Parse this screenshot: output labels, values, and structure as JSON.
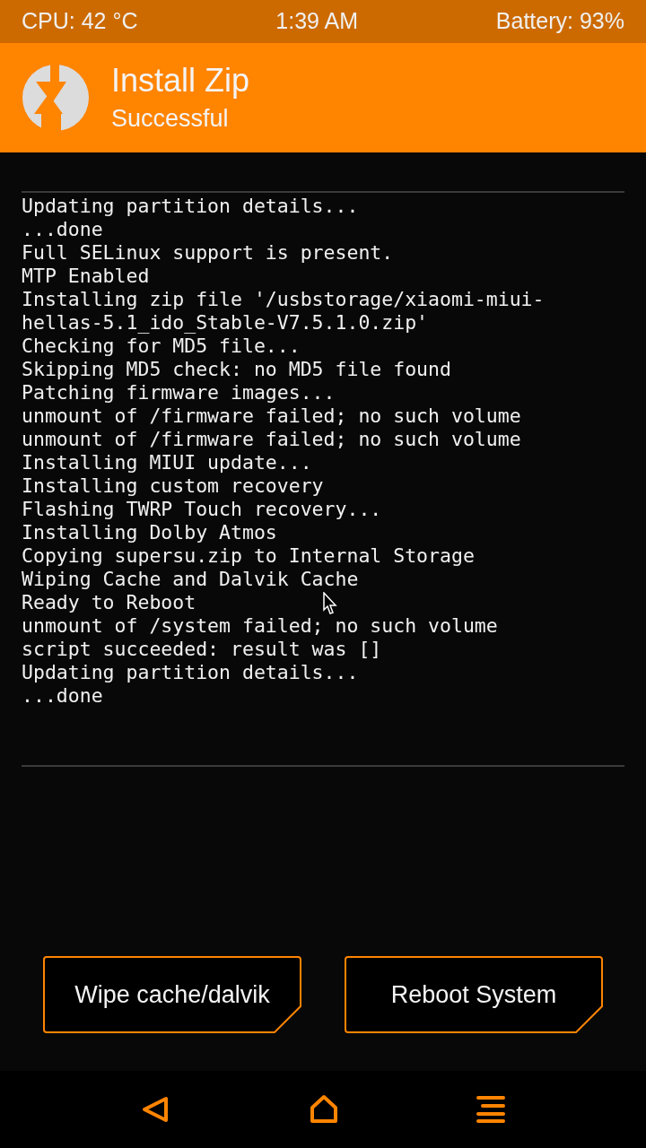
{
  "status_bar": {
    "cpu": "CPU: 42 °C",
    "time": "1:39 AM",
    "battery": "Battery: 93%"
  },
  "header": {
    "title": "Install Zip",
    "subtitle": "Successful"
  },
  "console": {
    "lines": [
      "Updating partition details...",
      "...done",
      "Full SELinux support is present.",
      "MTP Enabled",
      "Installing zip file '/usbstorage/xiaomi-miui-",
      "hellas-5.1_ido_Stable-V7.5.1.0.zip'",
      "Checking for MD5 file...",
      "Skipping MD5 check: no MD5 file found",
      "Patching firmware images...",
      "unmount of /firmware failed; no such volume",
      "unmount of /firmware failed; no such volume",
      "Installing MIUI update...",
      "Installing custom recovery",
      "Flashing TWRP Touch recovery...",
      "Installing Dolby Atmos",
      "Copying supersu.zip to Internal Storage",
      "Wiping Cache and Dalvik Cache",
      "Ready to Reboot",
      "unmount of /system failed; no such volume",
      "script succeeded: result was []",
      "Updating partition details...",
      "...done"
    ]
  },
  "buttons": [
    "Wipe cache/dalvik",
    "Reboot System"
  ],
  "nav": [
    {
      "kind": "back"
    },
    {
      "kind": "home"
    },
    {
      "kind": "menu"
    }
  ]
}
